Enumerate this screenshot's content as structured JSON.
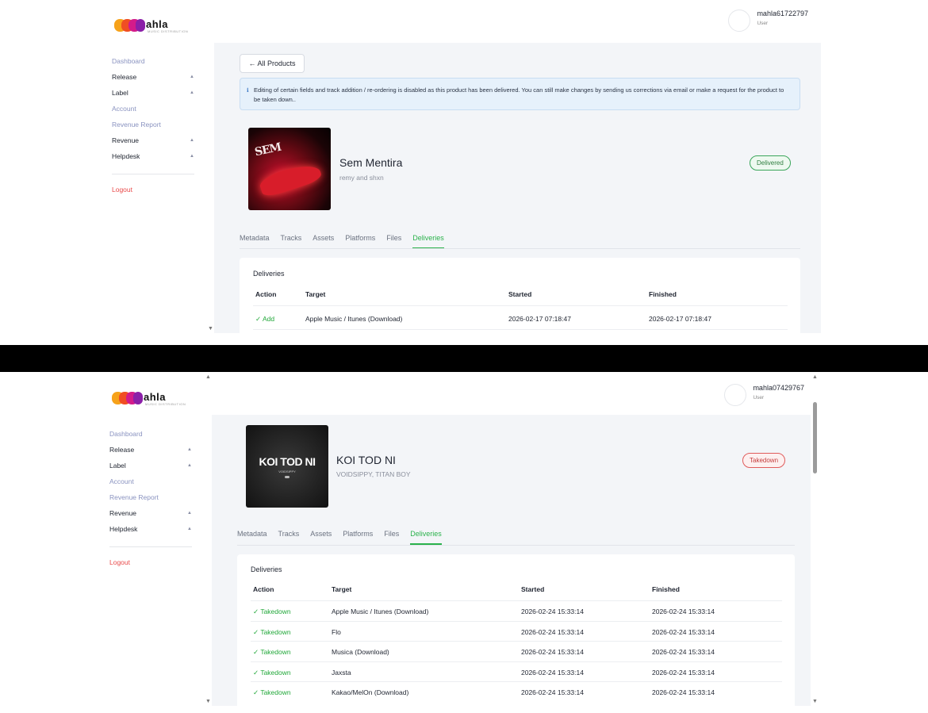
{
  "logo": {
    "word": "ahla",
    "tagline": "MUSIC DISTRIBUTION"
  },
  "sidebar": {
    "items": [
      {
        "label": "Dashboard",
        "chevron": false
      },
      {
        "label": "Release",
        "chevron": true
      },
      {
        "label": "Label",
        "chevron": true
      },
      {
        "label": "Account",
        "chevron": false
      },
      {
        "label": "Revenue Report",
        "chevron": false
      },
      {
        "label": "Revenue",
        "chevron": true
      },
      {
        "label": "Helpdesk",
        "chevron": true
      }
    ],
    "logout": "Logout",
    "chevron_glyph": "▲"
  },
  "screens": [
    {
      "user": {
        "name": "mahla61722797",
        "role": "User"
      },
      "back_button": "← All Products",
      "info_alert": "Editing of certain fields and track addition / re-ordering is disabled as this product has been delivered. You can still make changes by sending us corrections via email or make a request for the product to be taken down..",
      "product": {
        "title": "Sem Mentira",
        "artist": "remy and shxn",
        "status": "Delivered",
        "cover_text": "SEM"
      },
      "tabs": [
        "Metadata",
        "Tracks",
        "Assets",
        "Platforms",
        "Files",
        "Deliveries"
      ],
      "active_tab": "Deliveries",
      "deliveries": {
        "title": "Deliveries",
        "columns": [
          "Action",
          "Target",
          "Started",
          "Finished"
        ],
        "rows": [
          [
            "✓ Add",
            "Apple Music / Itunes (Download)",
            "2026-02-17 07:18:47",
            "2026-02-17 07:18:47"
          ]
        ]
      }
    },
    {
      "user": {
        "name": "mahla07429767",
        "role": "User"
      },
      "product": {
        "title": "KOI TOD NI",
        "artist": "VOIDSIPPY, TITAN BOY",
        "status": "Takedown",
        "cover_text": "KOI TOD NI",
        "cover_subtext": "VOIDSIPPY"
      },
      "tabs": [
        "Metadata",
        "Tracks",
        "Assets",
        "Platforms",
        "Files",
        "Deliveries"
      ],
      "active_tab": "Deliveries",
      "deliveries": {
        "title": "Deliveries",
        "columns": [
          "Action",
          "Target",
          "Started",
          "Finished"
        ],
        "rows": [
          [
            "✓ Takedown",
            "Apple Music / Itunes (Download)",
            "2026-02-24 15:33:14",
            "2026-02-24 15:33:14"
          ],
          [
            "✓ Takedown",
            "Flo",
            "2026-02-24 15:33:14",
            "2026-02-24 15:33:14"
          ],
          [
            "✓ Takedown",
            "Musica (Download)",
            "2026-02-24 15:33:14",
            "2026-02-24 15:33:14"
          ],
          [
            "✓ Takedown",
            "Jaxsta",
            "2026-02-24 15:33:14",
            "2026-02-24 15:33:14"
          ],
          [
            "✓ Takedown",
            "Kakao/MelOn (Download)",
            "2026-02-24 15:33:14",
            "2026-02-24 15:33:14"
          ]
        ]
      }
    }
  ],
  "colors": {
    "accent_green": "#2bb24c",
    "delivered": "#3aa55a",
    "takedown": "#e05b5b",
    "muted_nav": "#8a93c0",
    "logout": "#e94b4b"
  }
}
